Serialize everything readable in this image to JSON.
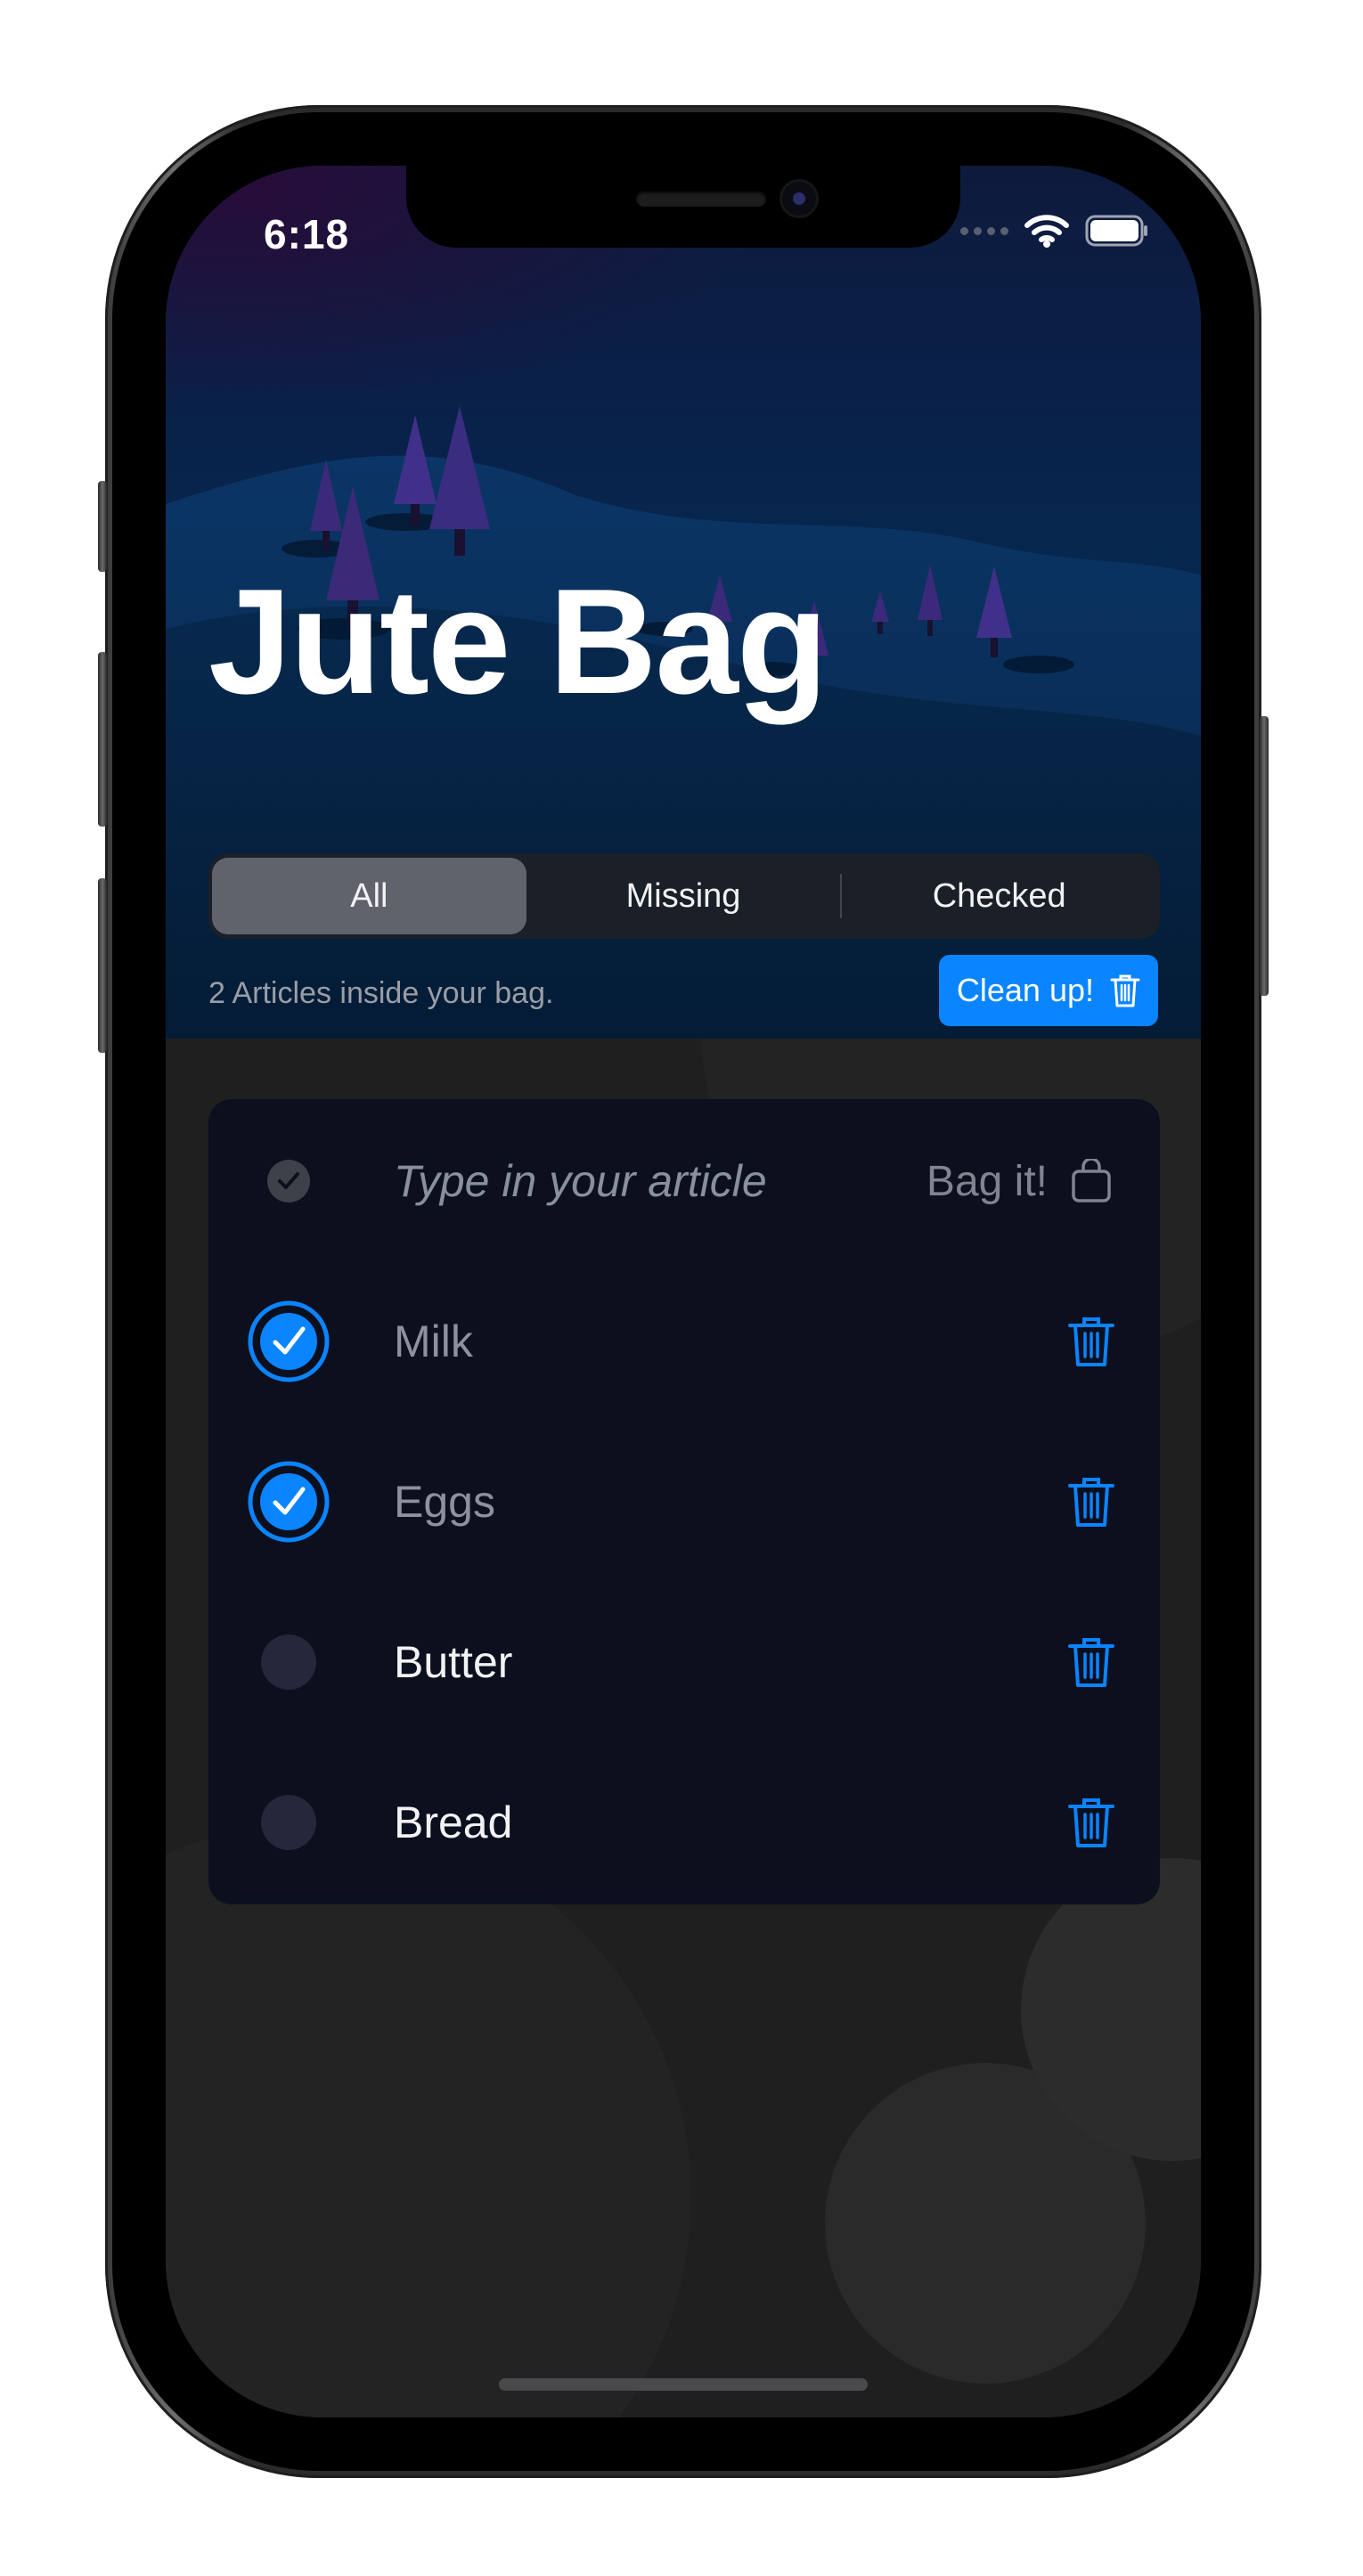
{
  "status_bar": {
    "time": "6:18"
  },
  "app": {
    "title": "Jute Bag"
  },
  "filter": {
    "segments": [
      {
        "label": "All"
      },
      {
        "label": "Missing"
      },
      {
        "label": "Checked"
      }
    ]
  },
  "summary": {
    "text": "2 Articles inside your bag.",
    "cleanup_label": "Clean up!"
  },
  "new_article": {
    "placeholder": "Type in your article",
    "bag_it_label": "Bag it!"
  },
  "items": [
    {
      "label": "Milk",
      "checked": true
    },
    {
      "label": "Eggs",
      "checked": true
    },
    {
      "label": "Butter",
      "checked": false
    },
    {
      "label": "Bread",
      "checked": false
    }
  ],
  "colors": {
    "accent": "#0a84ff",
    "card": "#0b0f1e",
    "background": "#1e1e1f"
  }
}
